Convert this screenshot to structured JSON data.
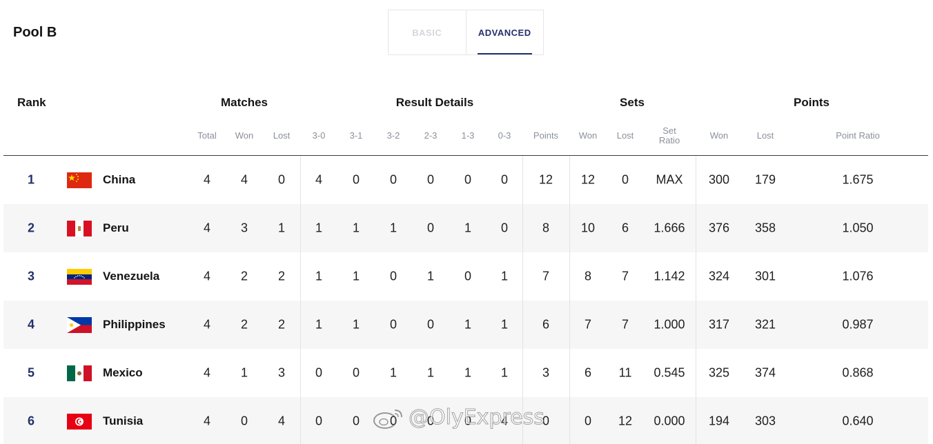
{
  "pool_title": "Pool B",
  "tabs": [
    {
      "label": "BASIC",
      "active": false
    },
    {
      "label": "ADVANCED",
      "active": true
    }
  ],
  "groups": {
    "rank": "Rank",
    "matches": "Matches",
    "result_details": "Result Details",
    "sets": "Sets",
    "points": "Points"
  },
  "sub_headers": {
    "total": "Total",
    "won": "Won",
    "lost": "Lost",
    "r30": "3-0",
    "r31": "3-1",
    "r32": "3-2",
    "r23": "2-3",
    "r13": "1-3",
    "r03": "0-3",
    "points": "Points",
    "sets_won": "Won",
    "sets_lost": "Lost",
    "set_ratio_1": "Set",
    "set_ratio_2": "Ratio",
    "pts_won": "Won",
    "pts_lost": "Lost",
    "point_ratio": "Point Ratio"
  },
  "teams": [
    {
      "rank": "1",
      "name": "China",
      "flag": "china-flag",
      "total": "4",
      "won": "4",
      "lost": "0",
      "r30": "4",
      "r31": "0",
      "r32": "0",
      "r23": "0",
      "r13": "0",
      "r03": "0",
      "points": "12",
      "sets_won": "12",
      "sets_lost": "0",
      "set_ratio": "MAX",
      "pts_won": "300",
      "pts_lost": "179",
      "point_ratio": "1.675"
    },
    {
      "rank": "2",
      "name": "Peru",
      "flag": "peru-flag",
      "total": "4",
      "won": "3",
      "lost": "1",
      "r30": "1",
      "r31": "1",
      "r32": "1",
      "r23": "0",
      "r13": "1",
      "r03": "0",
      "points": "8",
      "sets_won": "10",
      "sets_lost": "6",
      "set_ratio": "1.666",
      "pts_won": "376",
      "pts_lost": "358",
      "point_ratio": "1.050"
    },
    {
      "rank": "3",
      "name": "Venezuela",
      "flag": "venezuela-flag",
      "total": "4",
      "won": "2",
      "lost": "2",
      "r30": "1",
      "r31": "1",
      "r32": "0",
      "r23": "1",
      "r13": "0",
      "r03": "1",
      "points": "7",
      "sets_won": "8",
      "sets_lost": "7",
      "set_ratio": "1.142",
      "pts_won": "324",
      "pts_lost": "301",
      "point_ratio": "1.076"
    },
    {
      "rank": "4",
      "name": "Philippines",
      "flag": "philippines-flag",
      "total": "4",
      "won": "2",
      "lost": "2",
      "r30": "1",
      "r31": "1",
      "r32": "0",
      "r23": "0",
      "r13": "1",
      "r03": "1",
      "points": "6",
      "sets_won": "7",
      "sets_lost": "7",
      "set_ratio": "1.000",
      "pts_won": "317",
      "pts_lost": "321",
      "point_ratio": "0.987"
    },
    {
      "rank": "5",
      "name": "Mexico",
      "flag": "mexico-flag",
      "total": "4",
      "won": "1",
      "lost": "3",
      "r30": "0",
      "r31": "0",
      "r32": "1",
      "r23": "1",
      "r13": "1",
      "r03": "1",
      "points": "3",
      "sets_won": "6",
      "sets_lost": "11",
      "set_ratio": "0.545",
      "pts_won": "325",
      "pts_lost": "374",
      "point_ratio": "0.868"
    },
    {
      "rank": "6",
      "name": "Tunisia",
      "flag": "tunisia-flag",
      "total": "4",
      "won": "0",
      "lost": "4",
      "r30": "0",
      "r31": "0",
      "r32": "0",
      "r23": "0",
      "r13": "0",
      "r03": "4",
      "points": "0",
      "sets_won": "0",
      "sets_lost": "12",
      "set_ratio": "0.000",
      "pts_won": "194",
      "pts_lost": "303",
      "point_ratio": "0.640"
    }
  ],
  "watermark": "@OlyExpress",
  "colors": {
    "accent": "#23306b",
    "row_alt": "#f6f6f6"
  }
}
